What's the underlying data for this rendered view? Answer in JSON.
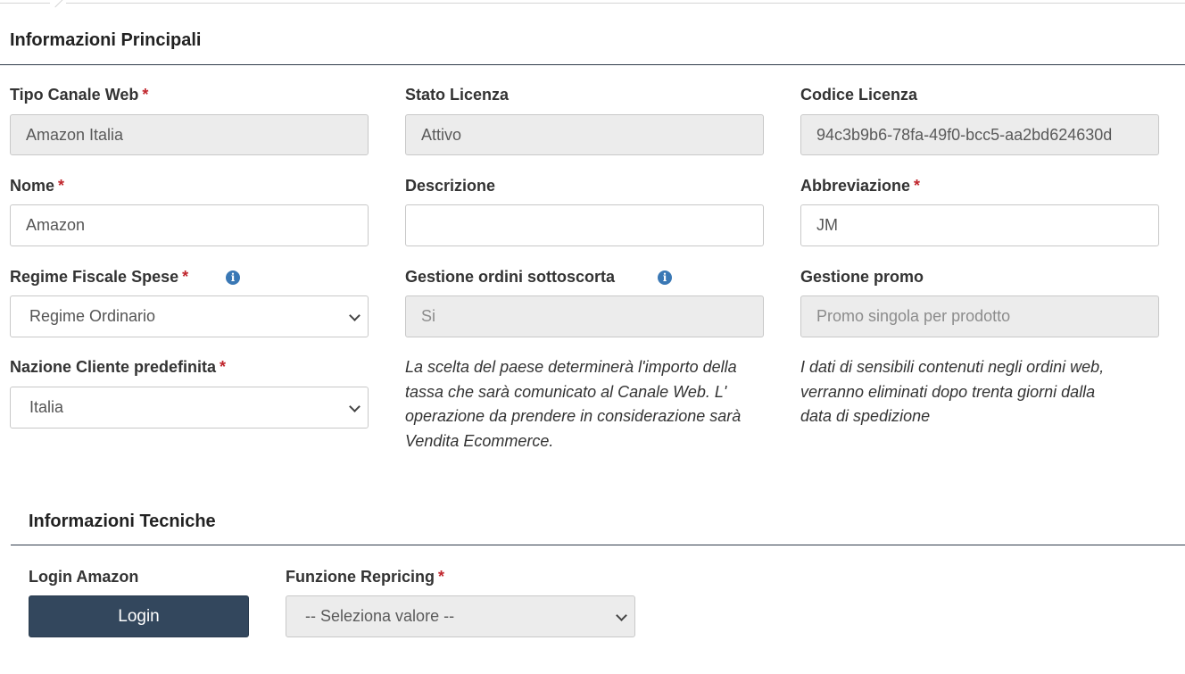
{
  "sections": {
    "main_title": "Informazioni Principali",
    "tech_title": "Informazioni Tecniche"
  },
  "required_mark": "*",
  "fields": {
    "tipo_canale": {
      "label": "Tipo Canale Web",
      "value": "Amazon Italia"
    },
    "stato_licenza": {
      "label": "Stato Licenza",
      "value": "Attivo"
    },
    "codice_licenza": {
      "label": "Codice Licenza",
      "value": "94c3b9b6-78fa-49f0-bcc5-aa2bd624630d"
    },
    "nome": {
      "label": "Nome",
      "value": "Amazon"
    },
    "descrizione": {
      "label": "Descrizione",
      "value": ""
    },
    "abbreviazione": {
      "label": "Abbreviazione",
      "value": "JM"
    },
    "regime_fiscale": {
      "label": "Regime Fiscale Spese",
      "value": "Regime Ordinario"
    },
    "gestione_sottoscorta": {
      "label": "Gestione ordini sottoscorta",
      "value": "Si"
    },
    "gestione_promo": {
      "label": "Gestione promo",
      "placeholder": "Promo singola per prodotto"
    },
    "nazione_cliente": {
      "label": "Nazione Cliente predefinita",
      "value": "Italia"
    },
    "login_amazon": {
      "label": "Login Amazon",
      "button": "Login"
    },
    "funzione_repricing": {
      "label": "Funzione Repricing",
      "placeholder": "-- Seleziona valore --"
    }
  },
  "notes": {
    "tassa_lines": [
      "La scelta del paese determinerà l'importo della",
      "tassa che sarà comunicato al Canale Web. L'",
      "operazione da prendere in considerazione sarà",
      "Vendita Ecommerce."
    ],
    "dati_lines": [
      "I dati di sensibili contenuti negli ordini web,",
      "verranno eliminati dopo trenta giorni dalla",
      "data di spedizione"
    ]
  },
  "colors": {
    "accent": "#33475d",
    "required": "#c0262d",
    "info_icon": "#3a78b5",
    "readonly_bg": "#ececec"
  },
  "icons": [
    "info-icon",
    "chevron-down-icon"
  ]
}
